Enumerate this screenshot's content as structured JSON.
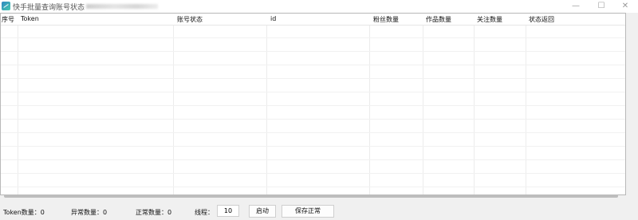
{
  "window": {
    "title": "快手批量查询账号状态",
    "minimize_glyph": "—",
    "maximize_glyph": "☐",
    "close_glyph": "✕"
  },
  "table": {
    "columns": [
      "序号",
      "Token",
      "账号状态",
      "id",
      "粉丝数量",
      "作品数量",
      "关注数量",
      "状态返回"
    ],
    "rows": []
  },
  "footer": {
    "token_count_label": "Token数量：0",
    "abnormal_count_label": "异常数量：0",
    "normal_count_label": "正常数量：0",
    "threads_label": "线程：",
    "threads_value": "10",
    "start_button": "启动",
    "save_button": "保存正常"
  },
  "colors": {
    "window_bg": "#f0f0f0",
    "grid_bg": "#ffffff",
    "grid_line": "#ececec"
  }
}
